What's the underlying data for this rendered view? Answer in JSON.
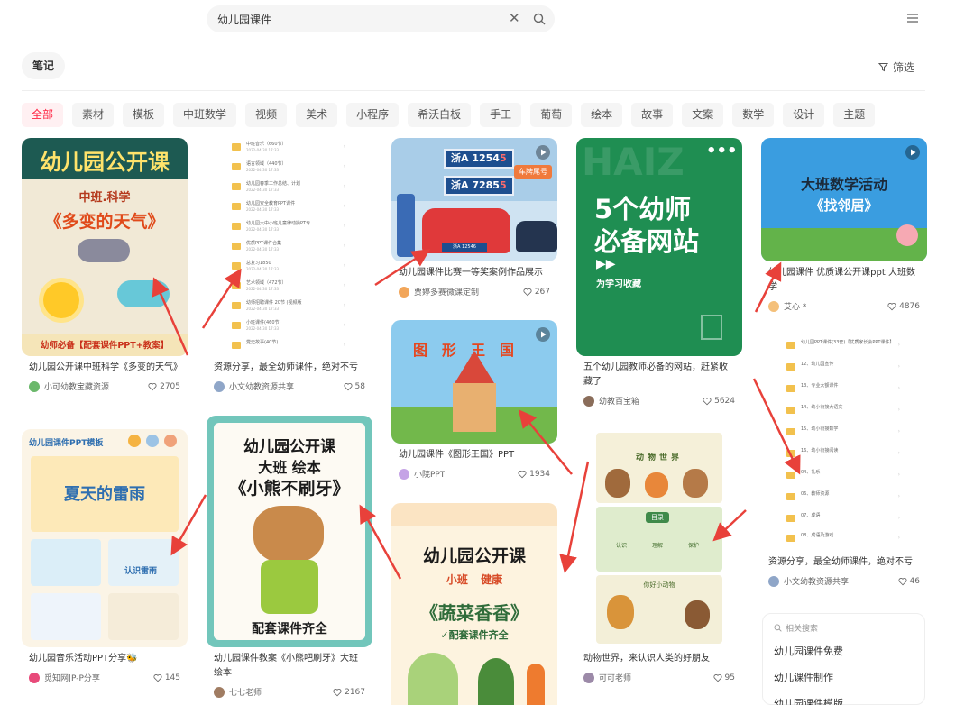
{
  "search": {
    "query": "幼儿园课件"
  },
  "header": {
    "notes_tab": "笔记",
    "filter_label": "筛选"
  },
  "chips": [
    "全部",
    "素材",
    "模板",
    "中班数学",
    "视频",
    "美术",
    "小程序",
    "希沃白板",
    "手工",
    "葡萄",
    "绘本",
    "故事",
    "文案",
    "数学",
    "设计",
    "主题"
  ],
  "cards": [
    {
      "title": "幼儿园公开课中班科学《多变的天气》",
      "author": "小可幼教宝藏资源",
      "likes": "2705",
      "cover": {
        "heading": "幼儿园公开课",
        "sub": "中班.科学",
        "main": "《多变的天气》",
        "footer": "幼师必备【配套课件PPT+教案】"
      }
    },
    {
      "title": "资源分享，最全幼师课件，绝对不亏",
      "author": "小文幼教资源共享",
      "likes": "58",
      "cover": {
        "folders": [
          {
            "name": "中班音乐（660节）",
            "date": "2022-04-30 17:33"
          },
          {
            "name": "语言领域（440节）",
            "date": "2022-04-30 17:33"
          },
          {
            "name": "幼儿园春季工作总结、计划",
            "date": "2022-04-30 17:33"
          },
          {
            "name": "幼儿园安全教育PPT课件",
            "date": "2022-04-30 17:33"
          },
          {
            "name": "幼儿园大中小班儿童律动操PT专",
            "date": "2022-04-30 17:33"
          },
          {
            "name": "优质PPT课件合集",
            "date": "2022-04-30 17:33"
          },
          {
            "name": "总复习1850",
            "date": "2022-04-30 17:33"
          },
          {
            "name": "艺术领域（472节）",
            "date": "2022-04-30 17:33"
          },
          {
            "name": "幼师招聘课件 20节 (视频版",
            "date": "2022-04-30 17:33"
          },
          {
            "name": "小班课件(460节)",
            "date": "2022-04-30 17:33"
          },
          {
            "name": "党史故事(40节)",
            "date": ""
          }
        ]
      }
    },
    {
      "title": "幼儿园课件比赛一等奖案例作品展示",
      "author": "贾婷多赛微课定制",
      "likes": "267",
      "cover": {
        "plate1": "浙A 1254",
        "plate1_tail": "5",
        "plate2": "浙A 7285",
        "plate2_tail": "5",
        "tag": "车牌尾号",
        "small_plate": "浙A 12546"
      }
    },
    {
      "title": "五个幼儿园教师必备的网站，赶紧收藏了",
      "author": "幼教百宝箱",
      "likes": "5624",
      "cover": {
        "line1": "5个幼师",
        "line2": "必备网站",
        "note": "为学习收藏",
        "bg_text": "HAIZ"
      }
    },
    {
      "title": "幼儿园课件 优质课公开课ppt 大班数学",
      "author": "艾心 *",
      "likes": "4876",
      "cover": {
        "line1": "大班数学活动",
        "line2": "《找邻居》"
      }
    },
    {
      "title": "幼儿园音乐活动PPT分享🐝",
      "title_prefix": "🐝",
      "author": "觅知网|P-P分享",
      "likes": "145",
      "cover": {
        "header": "幼儿园课件PPT模板",
        "main": "夏天的雷雨",
        "badge": "认识雷雨"
      }
    },
    {
      "title": "幼儿园课件教案《小熊吧刷牙》大班绘本",
      "author": "七七老师",
      "likes": "2167",
      "cover": {
        "line1": "幼儿园公开课",
        "line2": "大班  绘本",
        "line3": "《小熊不刷牙》",
        "footer": "配套课件齐全"
      }
    },
    {
      "title": "幼儿园课件《图形王国》PPT",
      "author": "小院PPT",
      "likes": "1934",
      "cover": {
        "title": "图形王国"
      }
    },
    {
      "title": "",
      "author": "",
      "likes": "",
      "cover": {
        "line1": "幼儿园公开课",
        "line2": "小班  健康",
        "line3": "《蔬菜香香》",
        "footer": "✓配套课件齐全"
      }
    },
    {
      "title": "动物世界，来认识人类的好朋友",
      "author": "可可老师",
      "likes": "95",
      "cover": {
        "title": "动物世界",
        "slide_label": "目录",
        "slide_items": [
          "认识",
          "理解",
          "保护"
        ],
        "bottom": "你好小动物"
      }
    },
    {
      "title": "资源分享，最全幼师课件，绝对不亏",
      "author": "小文幼教资源共享",
      "likes": "46",
      "cover": {
        "folders": [
          {
            "name": "幼儿园PPT课件(33套)【优质家长会PPT课件】",
            "date": ""
          },
          {
            "name": "12、幼儿园宣传",
            "date": ""
          },
          {
            "name": "13、专业大额课件",
            "date": ""
          },
          {
            "name": "14、幼小衔接大语文",
            "date": ""
          },
          {
            "name": "15、幼小衔接数学",
            "date": ""
          },
          {
            "name": "16、幼小衔接阅读",
            "date": ""
          },
          {
            "name": "04、礼乐",
            "date": ""
          },
          {
            "name": "06、教师资源",
            "date": ""
          },
          {
            "name": "07、成语",
            "date": ""
          },
          {
            "name": "08、成语及游戏",
            "date": ""
          }
        ]
      }
    }
  ],
  "related": {
    "heading": "相关搜索",
    "items": [
      "幼儿园课件免费",
      "幼儿课件制作",
      "幼儿园课件模版"
    ]
  },
  "colors": {
    "accent": "#ff2442",
    "annotation": "#e8413a"
  },
  "icons": [
    "close-icon",
    "search-icon",
    "menu-icon",
    "filter-icon",
    "heart-icon",
    "play-icon",
    "more-icon",
    "search-small-icon"
  ]
}
